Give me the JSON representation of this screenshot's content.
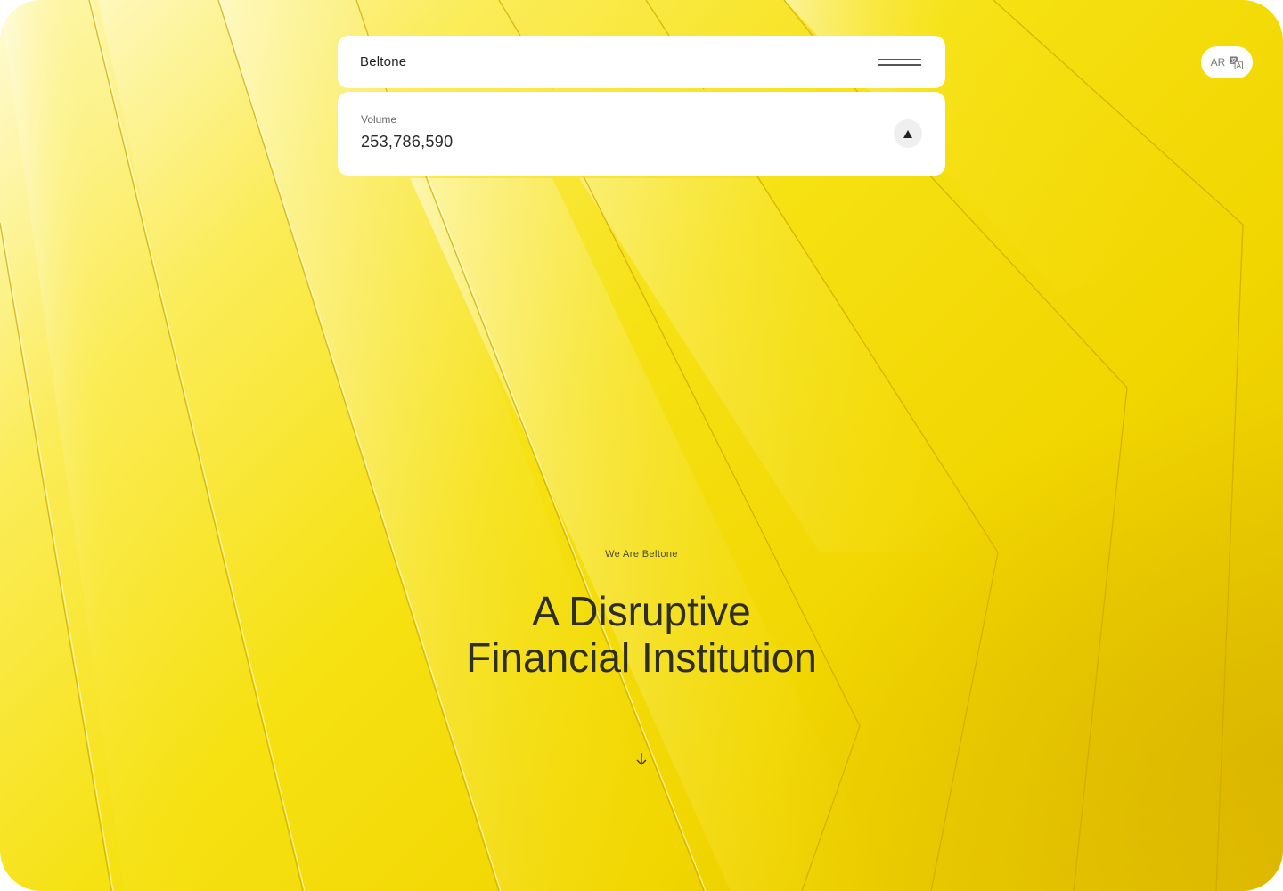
{
  "header": {
    "brand": "Beltone",
    "menu_icon": "hamburger-menu-icon"
  },
  "ticker": {
    "label": "Volume",
    "value": "253,786,590",
    "toggle_icon": "triangle-up-icon"
  },
  "language": {
    "label": "AR",
    "icon": "translate-icon"
  },
  "hero": {
    "eyebrow": "We Are Beltone",
    "headline_line1": "A Disruptive",
    "headline_line2": "Financial Institution",
    "scroll_icon": "arrow-down-icon"
  },
  "colors": {
    "accent_yellow": "#f4dc0a",
    "card_bg": "#ffffff",
    "text_dark": "#2e2e22"
  }
}
